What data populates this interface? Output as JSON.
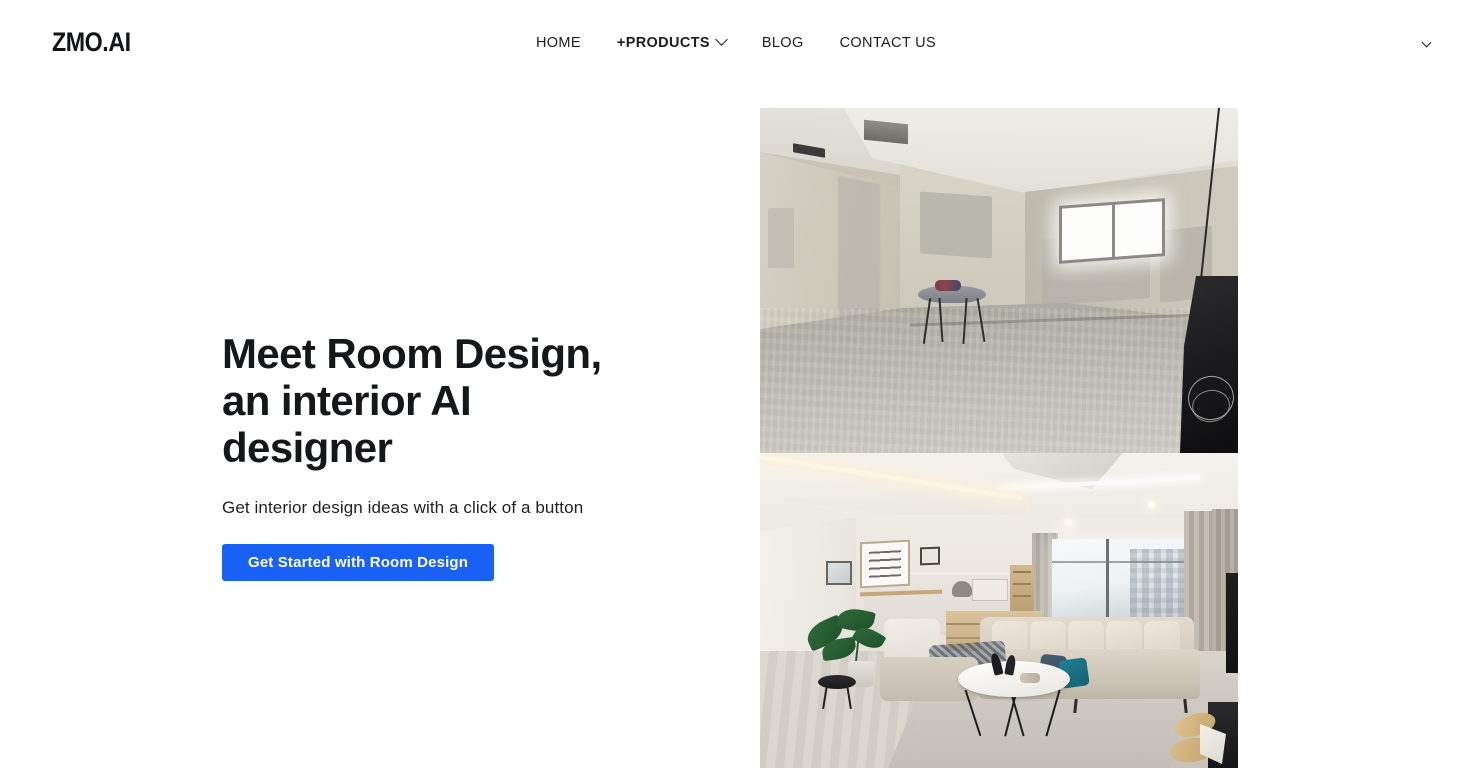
{
  "header": {
    "logo": "ZMO.AI",
    "nav": [
      {
        "label": "HOME",
        "name": "nav-home",
        "has_chevron": false,
        "strong": false
      },
      {
        "label": "+PRODUCTS",
        "name": "nav-products",
        "has_chevron": true,
        "strong": true
      },
      {
        "label": "BLOG",
        "name": "nav-blog",
        "has_chevron": false,
        "strong": false
      },
      {
        "label": "CONTACT US",
        "name": "nav-contact-us",
        "has_chevron": false,
        "strong": false
      }
    ],
    "language_toggle_icon": "chevron-down-icon"
  },
  "hero": {
    "title": "Meet Room Design,\nan interior AI\ndesigner",
    "subtitle": "Get interior design ideas with a click of a button",
    "cta_label": "Get Started with Room Design",
    "cta_color": "#1961f5",
    "media": {
      "before_alt": "Unfinished bare concrete room with raw plaster walls, a window and an ironing board",
      "after_alt": "Modern designed living room with beige sectional sofa, teal cushion, marble coffee table and plant"
    }
  },
  "colors": {
    "background": "#ffffff",
    "text": "#14171a",
    "accent": "#1961f5"
  }
}
